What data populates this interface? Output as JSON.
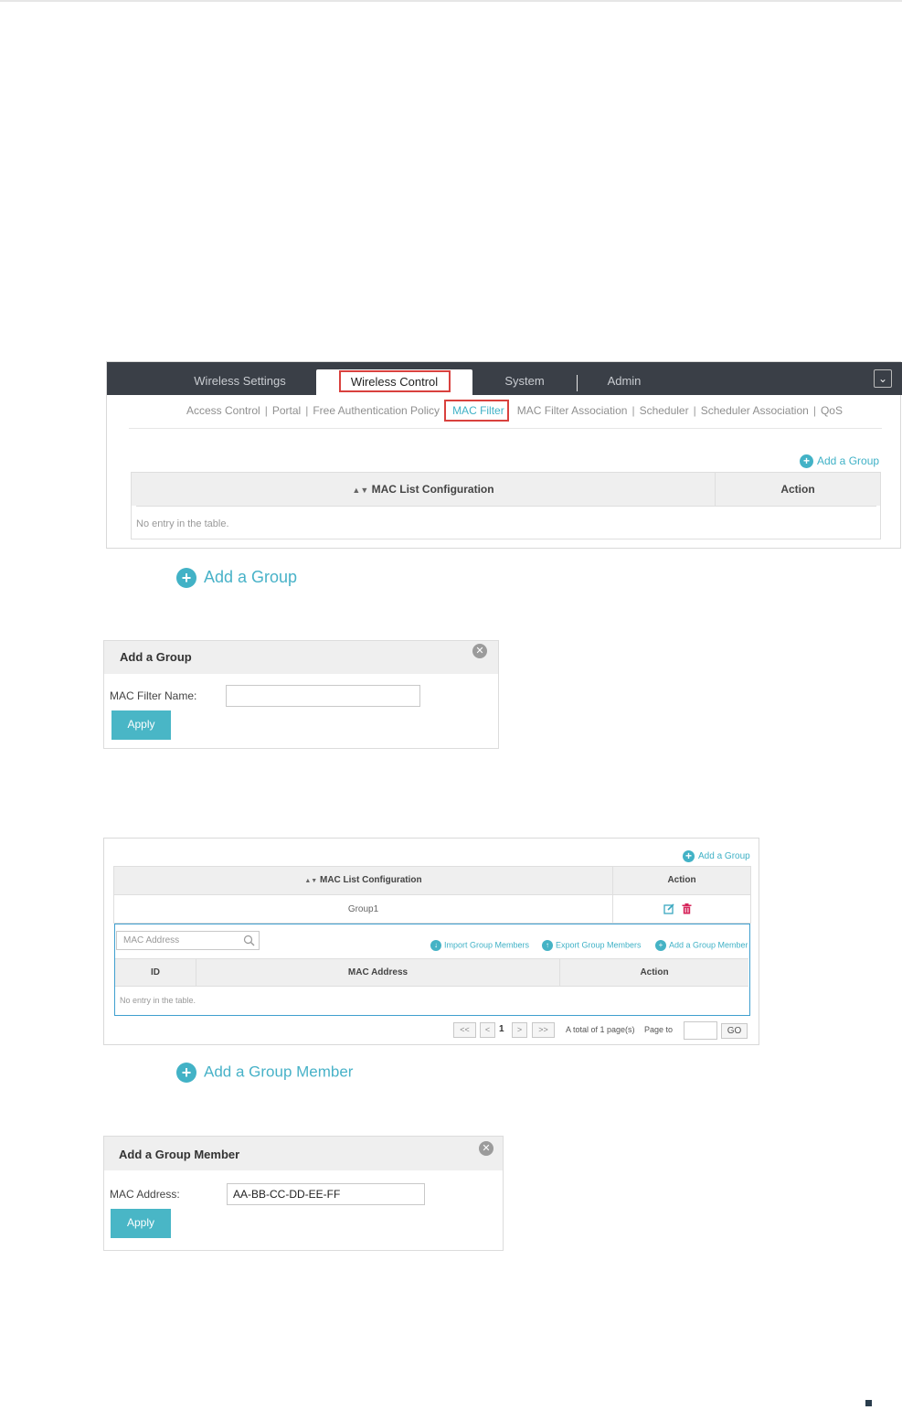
{
  "shot1": {
    "nav_tabs": [
      "Wireless Settings",
      "Wireless Control",
      "System",
      "Admin"
    ],
    "active_tab": "Wireless Control",
    "subnav": [
      "Access Control",
      "Portal",
      "Free Authentication Policy",
      "MAC Filter",
      "MAC Filter Association",
      "Scheduler",
      "Scheduler Association",
      "QoS"
    ],
    "active_subnav": "MAC Filter",
    "add_group_label": "Add a Group",
    "table": {
      "col_config": "MAC List Configuration",
      "col_action": "Action",
      "empty": "No entry in the table."
    }
  },
  "big_add_group": "Add a Group",
  "dialog_group": {
    "title": "Add a Group",
    "field_label": "MAC Filter Name:",
    "field_value": "",
    "apply": "Apply"
  },
  "shot3": {
    "add_group_label": "Add a Group",
    "table": {
      "col_config": "MAC List Configuration",
      "col_action": "Action",
      "row_group": "Group1"
    },
    "search_placeholder": "MAC Address",
    "import_label": "Import Group Members",
    "export_label": "Export Group Members",
    "add_member_label": "Add a Group Member",
    "sub_table": {
      "col_id": "ID",
      "col_mac": "MAC Address",
      "col_action": "Action",
      "empty": "No entry in the table."
    },
    "pagination": {
      "first": "<<",
      "prev": "<",
      "current": "1",
      "next": ">",
      "last": ">>",
      "total": "A total of 1 page(s)",
      "page_to": "Page to",
      "go": "GO"
    }
  },
  "big_add_member": "Add a Group Member",
  "dialog_member": {
    "title": "Add a Group Member",
    "field_label": "MAC Address:",
    "field_value": "AA-BB-CC-DD-EE-FF",
    "apply": "Apply"
  }
}
